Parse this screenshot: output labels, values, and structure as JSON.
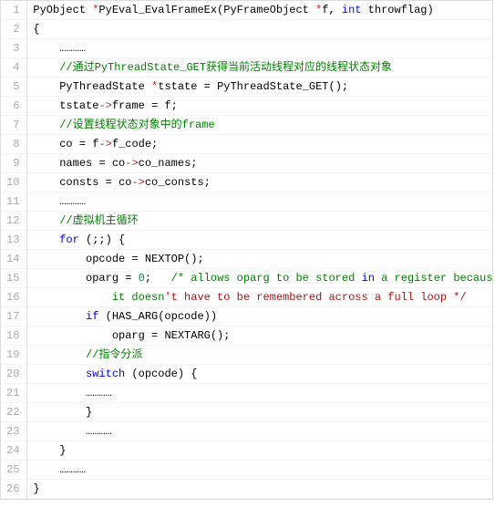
{
  "code": {
    "lines": [
      {
        "n": 1,
        "indent": 0,
        "tokens": [
          {
            "t": "PyObject ",
            "c": "tok-type"
          },
          {
            "t": "*",
            "c": "tok-ptr"
          },
          {
            "t": "PyEval_EvalFrameEx(PyFrameObject ",
            "c": "tok-func"
          },
          {
            "t": "*",
            "c": "tok-ptr"
          },
          {
            "t": "f, ",
            "c": "tok-param"
          },
          {
            "t": "int",
            "c": "tok-keyword"
          },
          {
            "t": " throwflag)",
            "c": "tok-param"
          }
        ]
      },
      {
        "n": 2,
        "indent": 0,
        "tokens": [
          {
            "t": "{",
            "c": "tok-op"
          }
        ]
      },
      {
        "n": 3,
        "indent": 1,
        "tokens": [
          {
            "t": "…………",
            "c": "tok-op"
          }
        ]
      },
      {
        "n": 4,
        "indent": 1,
        "tokens": [
          {
            "t": "//通过PyThreadState_GET获得当前活动线程对应的线程状态对象",
            "c": "tok-comment"
          }
        ]
      },
      {
        "n": 5,
        "indent": 1,
        "tokens": [
          {
            "t": "PyThreadState ",
            "c": "tok-type"
          },
          {
            "t": "*",
            "c": "tok-ptr"
          },
          {
            "t": "tstate ",
            "c": "tok-param"
          },
          {
            "t": "=",
            "c": "tok-op"
          },
          {
            "t": " PyThreadState_GET();",
            "c": "tok-func"
          }
        ]
      },
      {
        "n": 6,
        "indent": 1,
        "tokens": [
          {
            "t": "tstate",
            "c": "tok-param"
          },
          {
            "t": "->",
            "c": "tok-ptr"
          },
          {
            "t": "frame ",
            "c": "tok-param"
          },
          {
            "t": "=",
            "c": "tok-op"
          },
          {
            "t": " f;",
            "c": "tok-param"
          }
        ]
      },
      {
        "n": 7,
        "indent": 1,
        "tokens": [
          {
            "t": "//设置线程状态对象中的frame",
            "c": "tok-comment"
          }
        ]
      },
      {
        "n": 8,
        "indent": 1,
        "tokens": [
          {
            "t": "co ",
            "c": "tok-param"
          },
          {
            "t": "=",
            "c": "tok-op"
          },
          {
            "t": " f",
            "c": "tok-param"
          },
          {
            "t": "->",
            "c": "tok-ptr"
          },
          {
            "t": "f_code;",
            "c": "tok-param"
          }
        ]
      },
      {
        "n": 9,
        "indent": 1,
        "tokens": [
          {
            "t": "names ",
            "c": "tok-param"
          },
          {
            "t": "=",
            "c": "tok-op"
          },
          {
            "t": " co",
            "c": "tok-param"
          },
          {
            "t": "->",
            "c": "tok-ptr"
          },
          {
            "t": "co_names;",
            "c": "tok-param"
          }
        ]
      },
      {
        "n": 10,
        "indent": 1,
        "tokens": [
          {
            "t": "consts ",
            "c": "tok-param"
          },
          {
            "t": "=",
            "c": "tok-op"
          },
          {
            "t": " co",
            "c": "tok-param"
          },
          {
            "t": "->",
            "c": "tok-ptr"
          },
          {
            "t": "co_consts;",
            "c": "tok-param"
          }
        ]
      },
      {
        "n": 11,
        "indent": 1,
        "tokens": [
          {
            "t": "…………",
            "c": "tok-op"
          }
        ]
      },
      {
        "n": 12,
        "indent": 1,
        "tokens": [
          {
            "t": "//虚拟机主循环",
            "c": "tok-comment"
          }
        ]
      },
      {
        "n": 13,
        "indent": 1,
        "tokens": [
          {
            "t": "for",
            "c": "tok-keyword"
          },
          {
            "t": " (;;) {",
            "c": "tok-op"
          }
        ]
      },
      {
        "n": 14,
        "indent": 2,
        "tokens": [
          {
            "t": "opcode ",
            "c": "tok-param"
          },
          {
            "t": "=",
            "c": "tok-op"
          },
          {
            "t": " NEXTOP();",
            "c": "tok-func"
          }
        ]
      },
      {
        "n": 15,
        "indent": 2,
        "tokens": [
          {
            "t": "oparg ",
            "c": "tok-param"
          },
          {
            "t": "=",
            "c": "tok-op"
          },
          {
            "t": " ",
            "c": "tok-op"
          },
          {
            "t": "0",
            "c": "tok-num"
          },
          {
            "t": ";   ",
            "c": "tok-op"
          },
          {
            "t": "/* allows oparg to be stored ",
            "c": "tok-comment"
          },
          {
            "t": "in",
            "c": "tok-keyword"
          },
          {
            "t": " a register because",
            "c": "tok-comment"
          }
        ]
      },
      {
        "n": 16,
        "indent": 3,
        "tokens": [
          {
            "t": "it doesn",
            "c": "tok-comment"
          },
          {
            "t": "'t have to be remembered across a full loop */",
            "c": "tok-string"
          }
        ]
      },
      {
        "n": 17,
        "indent": 2,
        "tokens": [
          {
            "t": "if",
            "c": "tok-keyword"
          },
          {
            "t": " (HAS_ARG(opcode))",
            "c": "tok-func"
          }
        ]
      },
      {
        "n": 18,
        "indent": 3,
        "tokens": [
          {
            "t": "oparg ",
            "c": "tok-param"
          },
          {
            "t": "=",
            "c": "tok-op"
          },
          {
            "t": " NEXTARG();",
            "c": "tok-func"
          }
        ]
      },
      {
        "n": 19,
        "indent": 2,
        "tokens": [
          {
            "t": "//指令分派",
            "c": "tok-comment"
          }
        ]
      },
      {
        "n": 20,
        "indent": 2,
        "tokens": [
          {
            "t": "switch",
            "c": "tok-keyword"
          },
          {
            "t": " (opcode) {",
            "c": "tok-op"
          }
        ]
      },
      {
        "n": 21,
        "indent": 2,
        "tokens": [
          {
            "t": "…………",
            "c": "tok-op"
          }
        ]
      },
      {
        "n": 22,
        "indent": 2,
        "tokens": [
          {
            "t": "}",
            "c": "tok-op"
          }
        ]
      },
      {
        "n": 23,
        "indent": 2,
        "tokens": [
          {
            "t": "…………",
            "c": "tok-op"
          }
        ]
      },
      {
        "n": 24,
        "indent": 1,
        "tokens": [
          {
            "t": "}",
            "c": "tok-op"
          }
        ]
      },
      {
        "n": 25,
        "indent": 1,
        "tokens": [
          {
            "t": "…………",
            "c": "tok-op"
          }
        ]
      },
      {
        "n": 26,
        "indent": 0,
        "tokens": [
          {
            "t": "}",
            "c": "tok-op"
          }
        ]
      }
    ],
    "indent_unit": "    "
  }
}
